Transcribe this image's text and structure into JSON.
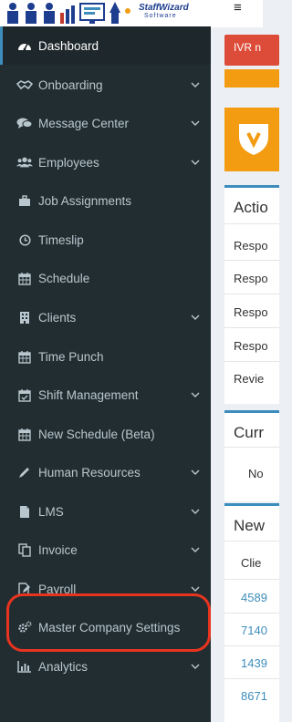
{
  "logo": {
    "brand": "StaffWizard",
    "tagline": "Software"
  },
  "topbar": {
    "menu_glyph": "≡"
  },
  "sidebar": {
    "items": [
      {
        "label": "Dashboard",
        "icon": "dashboard-icon",
        "active": true,
        "chevron": false
      },
      {
        "label": "Onboarding",
        "icon": "handshake-icon",
        "chevron": true
      },
      {
        "label": "Message Center",
        "icon": "comments-icon",
        "chevron": true
      },
      {
        "label": "Employees",
        "icon": "users-icon",
        "chevron": true
      },
      {
        "label": "Job Assignments",
        "icon": "briefcase-icon",
        "chevron": false
      },
      {
        "label": "Timeslip",
        "icon": "clock-icon",
        "chevron": false
      },
      {
        "label": "Schedule",
        "icon": "calendar-icon",
        "chevron": false
      },
      {
        "label": "Clients",
        "icon": "building-icon",
        "chevron": true
      },
      {
        "label": "Time Punch",
        "icon": "calendar-icon",
        "chevron": false
      },
      {
        "label": "Shift Management",
        "icon": "calendar-check-icon",
        "chevron": true
      },
      {
        "label": "New Schedule (Beta)",
        "icon": "calendar-icon",
        "chevron": false
      },
      {
        "label": "Human Resources",
        "icon": "pencil-icon",
        "chevron": true
      },
      {
        "label": "LMS",
        "icon": "file-icon",
        "chevron": true
      },
      {
        "label": "Invoice",
        "icon": "copy-icon",
        "chevron": true
      },
      {
        "label": "Payroll",
        "icon": "file-edit-icon",
        "chevron": true
      },
      {
        "label": "Master Company Settings",
        "icon": "gears-icon",
        "chevron": false
      },
      {
        "label": "Analytics",
        "icon": "bar-chart-icon",
        "chevron": true
      }
    ]
  },
  "main": {
    "alert_label": "IVR n",
    "actions_box": {
      "title": "Actio",
      "rows": [
        "Respo",
        "Respo",
        "Respo",
        "Respo",
        "Revie"
      ]
    },
    "current_box": {
      "title": "Curr",
      "row": "No"
    },
    "new_box": {
      "title": "New",
      "header": "Clie",
      "links": [
        "4589",
        "7140",
        "1439",
        "8671"
      ]
    }
  },
  "colors": {
    "sidebar_bg": "#222d32",
    "active_bg": "#1e282c",
    "accent": "#3c8dbc",
    "alert": "#dd4b39",
    "orange": "#f39c12",
    "highlight": "#e8341f"
  }
}
